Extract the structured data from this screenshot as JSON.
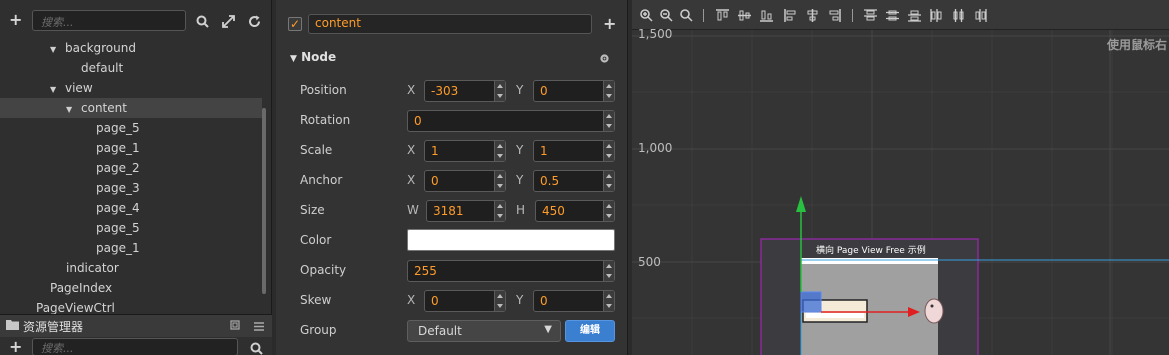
{
  "hierarchy": {
    "search_placeholder": "搜索...",
    "tree": [
      {
        "label": "background",
        "indent": 1,
        "arrow": true,
        "selected": false
      },
      {
        "label": "default",
        "indent": 2,
        "arrow": false,
        "selected": false
      },
      {
        "label": "view",
        "indent": 1,
        "arrow": true,
        "selected": false
      },
      {
        "label": "content",
        "indent": 2,
        "arrow": true,
        "selected": true
      },
      {
        "label": "page_5",
        "indent": 3,
        "arrow": false,
        "selected": false
      },
      {
        "label": "page_1",
        "indent": 3,
        "arrow": false,
        "selected": false
      },
      {
        "label": "page_2",
        "indent": 3,
        "arrow": false,
        "selected": false
      },
      {
        "label": "page_3",
        "indent": 3,
        "arrow": false,
        "selected": false
      },
      {
        "label": "page_4",
        "indent": 3,
        "arrow": false,
        "selected": false
      },
      {
        "label": "page_5",
        "indent": 3,
        "arrow": false,
        "selected": false
      },
      {
        "label": "page_1",
        "indent": 3,
        "arrow": false,
        "selected": false
      },
      {
        "label": "indicator",
        "indent": 1,
        "arrow": false,
        "selected": false
      },
      {
        "label": "PageIndex",
        "indent": 0,
        "arrow": false,
        "selected": false
      },
      {
        "label": "PageViewCtrl",
        "indent": -1,
        "arrow": false,
        "selected": false
      }
    ]
  },
  "assets": {
    "title": "资源管理器",
    "search_placeholder": "搜索..."
  },
  "properties": {
    "node_name": "content",
    "node_enabled": true,
    "section_title": "Node",
    "position": {
      "label": "Position",
      "x_label": "X",
      "x": "-303",
      "y_label": "Y",
      "y": "0"
    },
    "rotation": {
      "label": "Rotation",
      "value": "0"
    },
    "scale": {
      "label": "Scale",
      "x_label": "X",
      "x": "1",
      "y_label": "Y",
      "y": "1"
    },
    "anchor": {
      "label": "Anchor",
      "x_label": "X",
      "x": "0",
      "y_label": "Y",
      "y": "0.5"
    },
    "size": {
      "label": "Size",
      "w_label": "W",
      "w": "3181",
      "h_label": "H",
      "h": "450"
    },
    "color": {
      "label": "Color",
      "value": "#ffffff"
    },
    "opacity": {
      "label": "Opacity",
      "value": "255"
    },
    "skew": {
      "label": "Skew",
      "x_label": "X",
      "x": "0",
      "y_label": "Y",
      "y": "0"
    },
    "group": {
      "label": "Group",
      "value": "Default",
      "edit_label": "编辑"
    }
  },
  "scene": {
    "y_labels": [
      "1,500",
      "1,000",
      "500"
    ],
    "hint": "使用鼠标右",
    "canvas_title": "横向 Page View Free 示例",
    "colors": {
      "purple_frame": "#8a2a9a",
      "blue_line": "#3aa0e0",
      "arrow_red": "#e02020",
      "arrow_green": "#28c040"
    }
  }
}
